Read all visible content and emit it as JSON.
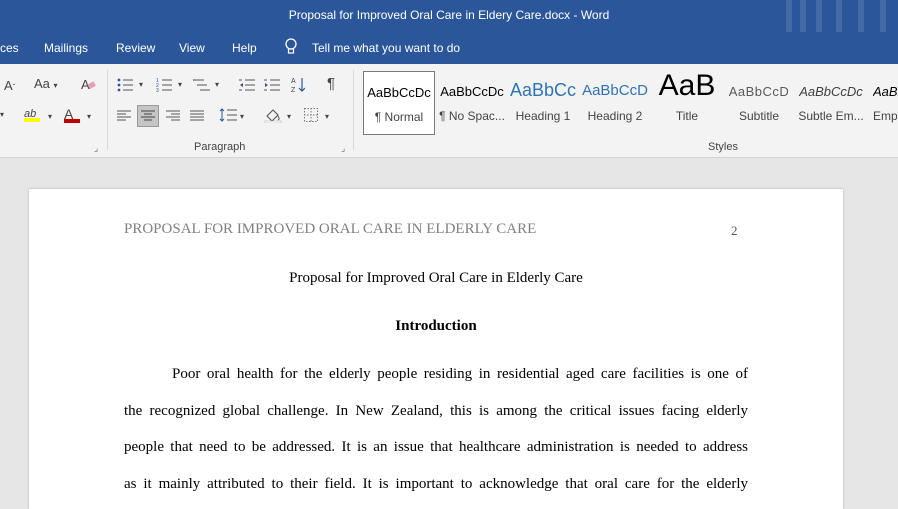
{
  "window": {
    "title": "Proposal for Improved Oral Care in Eldery Care.docx  -  Word"
  },
  "menu": {
    "references_partial": "ces",
    "mailings": "Mailings",
    "review": "Review",
    "view": "View",
    "help": "Help",
    "tell_me": "Tell me what you want to do"
  },
  "ribbon": {
    "font_small": "A",
    "change_case": "Aa",
    "highlight_glyph": "ab",
    "font_color_glyph": "A",
    "pilcrow": "¶",
    "paragraph_label": "Paragraph",
    "styles_label": "Styles",
    "styles": [
      {
        "preview": "AaBbCcDc",
        "label": "¶ Normal"
      },
      {
        "preview": "AaBbCcDc",
        "label": "¶ No Spac..."
      },
      {
        "preview": "AaBbCc",
        "label": "Heading 1"
      },
      {
        "preview": "AaBbCcD",
        "label": "Heading 2"
      },
      {
        "preview": "AaB",
        "label": "Title"
      },
      {
        "preview": "AaBbCcD",
        "label": "Subtitle"
      },
      {
        "preview": "AaBbCcDc",
        "label": "Subtle Em..."
      },
      {
        "preview": "AaBb",
        "label": "Emp"
      }
    ],
    "heading_color": "#2e74b5",
    "highlight_color": "#ffff00",
    "font_color": "#c00000"
  },
  "document": {
    "running_header": "PROPOSAL FOR IMPROVED ORAL CARE IN ELDERLY CARE",
    "page_number": "2",
    "title": "Proposal for Improved Oral Care in Elderly Care",
    "heading": "Introduction",
    "lines": [
      "Poor oral health for the elderly people residing in residential aged care facilities is one of",
      "the recognized global challenge. In New Zealand, this is among the critical issues facing elderly",
      "people that need to be addressed.  It is an issue that healthcare administration is needed to address",
      "as it mainly attributed to their field. It is important to acknowledge that oral care for the elderly"
    ]
  },
  "colors": {
    "titlebar": "#2b579a"
  }
}
